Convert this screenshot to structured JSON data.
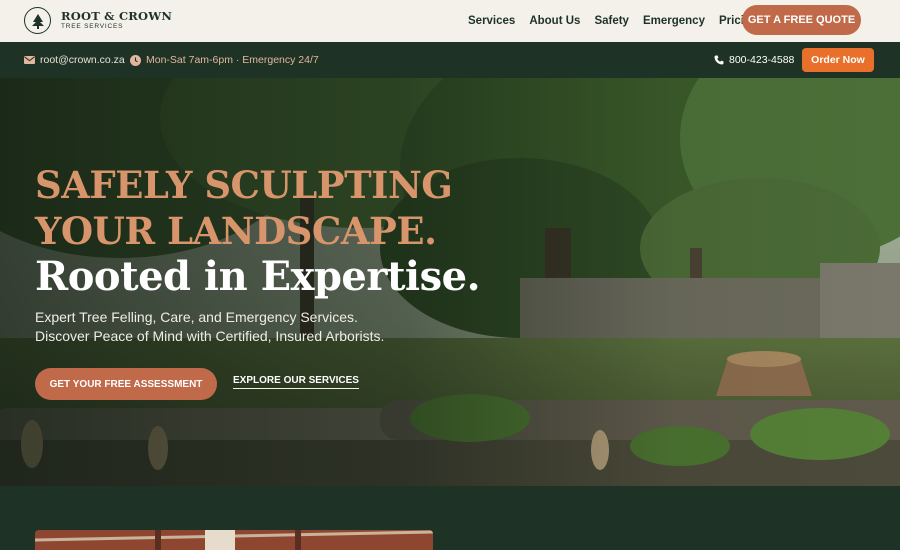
{
  "header": {
    "logo": {
      "name": "ROOT & CROWN",
      "tagline": "TREE SERVICES",
      "icon": "tree-icon"
    },
    "nav": [
      {
        "label": "Services"
      },
      {
        "label": "About Us"
      },
      {
        "label": "Safety"
      },
      {
        "label": "Emergency"
      },
      {
        "label": "Pricing"
      }
    ],
    "quote_button": "GET A FREE QUOTE"
  },
  "topbar": {
    "email": "root@crown.co.za",
    "email_icon": "envelope-icon",
    "hours": "Mon-Sat 7am-6pm · Emergency 24/7",
    "hours_icon": "clock-icon",
    "phone": "800-423-4588",
    "phone_icon": "phone-icon",
    "order_button": "Order Now"
  },
  "hero": {
    "headline_line1": "SAFELY SCULPTING",
    "headline_line2": "YOUR LANDSCAPE.",
    "headline_line3": "Rooted in Expertise.",
    "sub_line1": "Expert Tree Felling, Care, and Emergency Services.",
    "sub_line2": "Discover Peace of Mind with Certified, Insured Arborists.",
    "primary_cta": "GET YOUR FREE ASSESSMENT",
    "secondary_cta": "EXPLORE OUR SERVICES"
  },
  "colors": {
    "brand_dark": "#1e3326",
    "accent_terracotta": "#c06a4a",
    "accent_orange": "#e8702a",
    "headline_peach": "#d8956c",
    "header_bg": "#f4f1ea"
  }
}
